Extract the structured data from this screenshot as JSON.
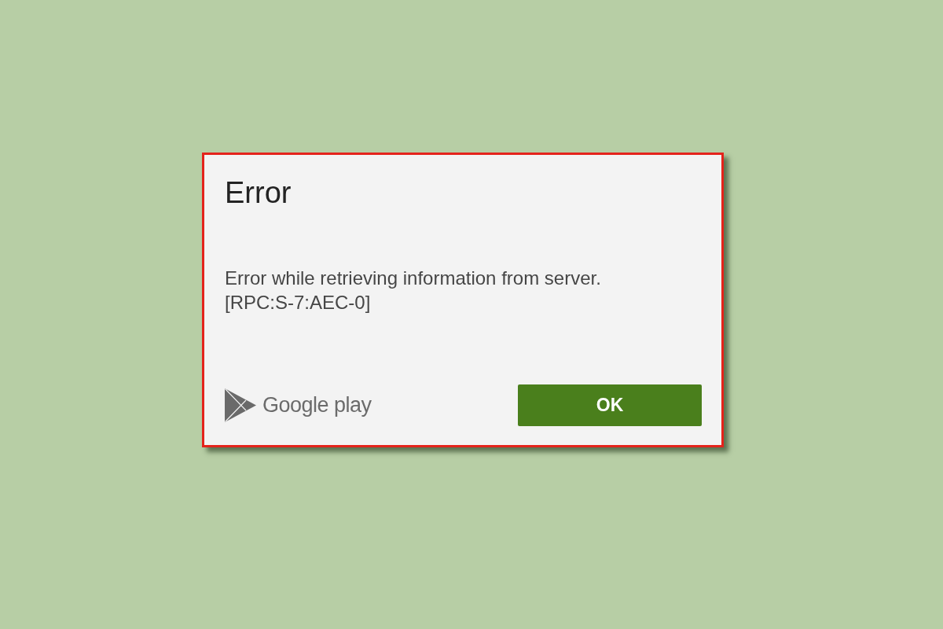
{
  "dialog": {
    "title": "Error",
    "message": "Error while retrieving information from server.",
    "error_code": "[RPC:S-7:AEC-0]",
    "brand": "Google play",
    "buttons": [
      "OK"
    ]
  }
}
